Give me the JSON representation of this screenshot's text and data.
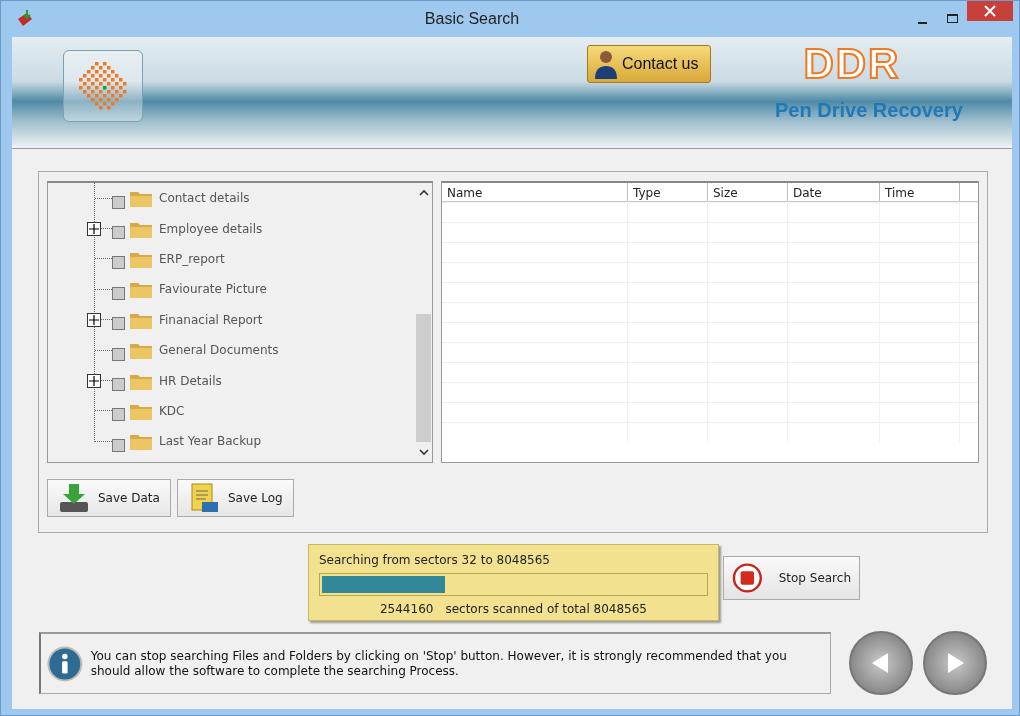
{
  "window": {
    "title": "Basic Search"
  },
  "header": {
    "contact_button": "Contact us",
    "logo": "DDR",
    "product": "Pen Drive Recovery"
  },
  "tree": {
    "items": [
      {
        "label": "Contact details",
        "checked": false,
        "expandable": false
      },
      {
        "label": "Employee details",
        "checked": false,
        "expandable": true
      },
      {
        "label": "ERP_report",
        "checked": false,
        "expandable": false
      },
      {
        "label": "Faviourate Picture",
        "checked": false,
        "expandable": false
      },
      {
        "label": "Finanacial Report",
        "checked": false,
        "expandable": true
      },
      {
        "label": "General Documents",
        "checked": false,
        "expandable": false
      },
      {
        "label": "HR Details",
        "checked": false,
        "expandable": true
      },
      {
        "label": "KDC",
        "checked": false,
        "expandable": false
      },
      {
        "label": "Last Year Backup",
        "checked": false,
        "expandable": false
      }
    ]
  },
  "table": {
    "columns": [
      "Name",
      "Type",
      "Size",
      "Date",
      "Time"
    ]
  },
  "buttons": [
    {
      "kind": "save-data",
      "label": "Save Data"
    },
    {
      "kind": "save-log",
      "label": "Save Log"
    }
  ],
  "progress": {
    "range_text": "Searching from sectors 32 to 8048565",
    "level": 0.32,
    "scanned": "2544160",
    "scanned_text": "sectors scanned of total 8048565"
  },
  "stop_button": "Stop Search",
  "info": "You can stop searching Files and Folders by clicking on 'Stop' button. However, it is strongly recommended that you should allow the software to complete the searching Process."
}
